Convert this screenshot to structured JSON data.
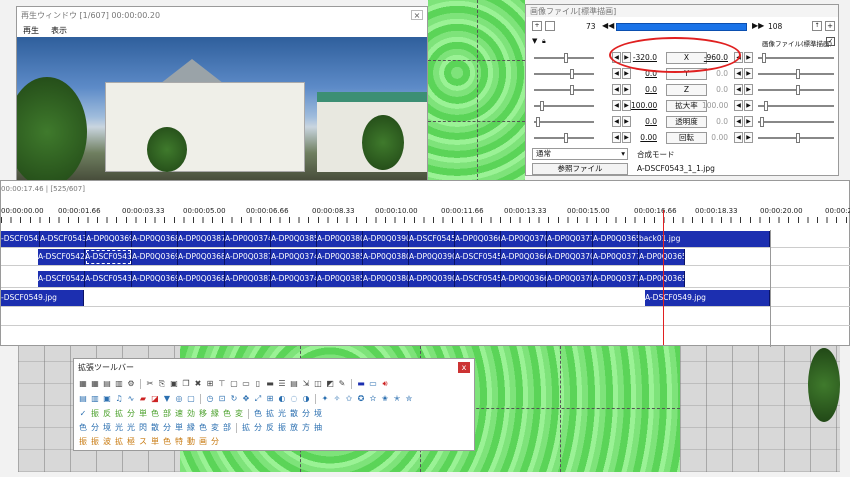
{
  "preview": {
    "title": "再生ウィンドウ [1/607]  00:00:00.20",
    "menus": [
      "再生",
      "表示"
    ],
    "close": "×"
  },
  "props": {
    "title": "画像ファイル[標準描画]",
    "frame_start": "73",
    "frame_end": "108",
    "label_right": "画像ファイル(標準描画)",
    "rows": [
      {
        "left": "-320.0",
        "name": "X",
        "right": "-960.0"
      },
      {
        "left": "0.0",
        "name": "Y",
        "right": "0.0"
      },
      {
        "left": "0.0",
        "name": "Z",
        "right": "0.0"
      },
      {
        "left": "100.00",
        "name": "拡大率",
        "right": "100.00"
      },
      {
        "left": "0.0",
        "name": "透明度",
        "right": "0.0"
      },
      {
        "left": "0.00",
        "name": "回転",
        "right": "0.00"
      }
    ],
    "blend_value": "通常",
    "blend_label": "合成モード",
    "ref_button": "参照ファイル",
    "filename": "A-DSCF0543_1_1.jpg"
  },
  "timeline": {
    "status": "00:00:17.46 | [525/607]",
    "ticks": [
      "00:00:00.00",
      "00:00:01.66",
      "00:00:03.33",
      "00:00:05.00",
      "00:00:06.66",
      "00:00:08.33",
      "00:00:10.00",
      "00:00:11.66",
      "00:00:13.33",
      "00:00:15.00",
      "00:00:16.66",
      "00:00:18.33",
      "00:00:20.00",
      "00:00:21"
    ],
    "layer1": [
      "-DSCF0542.",
      "A-DSCF0543.",
      "A-DP0Q0369",
      "A-DP0Q0368",
      "A-DP0Q0387",
      "A-DP0Q0374",
      "A-DP0Q0385",
      "A-DP0Q0380",
      "A-DP0Q0390",
      "A-DSCF0545.",
      "A-DP0Q0366",
      "A-DP0Q0370",
      "A-DP0Q0377",
      "A-DP0Q0365",
      "back01.jpg"
    ],
    "layer2": [
      "A-DSCF0542.",
      "A-DSCF0543.",
      "A-DP0Q0369",
      "A-DP0Q0368",
      "A-DP0Q0387",
      "A-DP0Q0374",
      "A-DP0Q0385",
      "A-DP0Q0380",
      "A-DP0Q0390",
      "A-DSCF0545.",
      "A-DP0Q0366",
      "A-DP0Q0370",
      "A-DP0Q0377",
      "A-DP0Q0365"
    ],
    "layer3": [
      "A-DSCF0542.",
      "A-DSCF0543.",
      "A-DP0Q0369",
      "A-DP0Q0368",
      "A-DP0Q0387",
      "A-DP0Q0374",
      "A-DP0Q0385",
      "A-DP0Q0380",
      "A-DP0Q0390",
      "A-DSCF0545.",
      "A-DP0Q0366",
      "A-DP0Q0370",
      "A-DP0Q0377",
      "A-DP0Q0365"
    ],
    "layer4_a": "-DSCF0549.jpg",
    "layer4_b": "A-DSCF0549.jpg"
  },
  "toolbar": {
    "title": "拡張ツールバー",
    "close": "x",
    "row3": [
      "振",
      "反",
      "拡",
      "分",
      "単",
      "色",
      "部",
      "速",
      "効",
      "移",
      "縁",
      "色",
      "変"
    ],
    "row3b": [
      "色",
      "拡",
      "光",
      "散",
      "分",
      "境"
    ],
    "row4": [
      "色",
      "分",
      "境",
      "光",
      "光",
      "閃",
      "散",
      "分",
      "単",
      "縁",
      "色",
      "変",
      "部",
      "拡",
      "分",
      "反",
      "振",
      "放",
      "方",
      "抽"
    ],
    "row5": [
      "振",
      "振",
      "波",
      "拡",
      "極",
      "ス",
      "単",
      "色",
      "特",
      "動",
      "画",
      "分"
    ]
  }
}
